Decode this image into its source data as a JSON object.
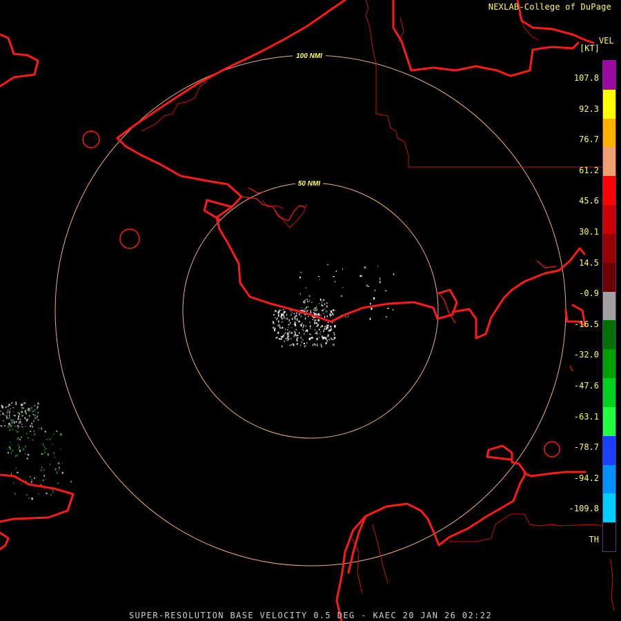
{
  "credit": "NEXLAB-College of DuPage",
  "product_title": "SUPER-RESOLUTION BASE VELOCITY 0.5 DEG - KAEC 20 JAN 26 02:22",
  "legend": {
    "title": "VEL",
    "units": "[KT]",
    "ticks": [
      "107.8",
      "92.3",
      "76.7",
      "61.2",
      "45.6",
      "30.1",
      "14.5",
      "-0.9",
      "-16.5",
      "-32.0",
      "-47.6",
      "-63.1",
      "-78.7",
      "-94.2",
      "-109.8",
      "TH"
    ],
    "colors": [
      "#9a0aa0",
      "#ffff00",
      "#ffb000",
      "#f0a070",
      "#ff0000",
      "#c80000",
      "#960000",
      "#6a0000",
      "#a0a0a0",
      "#007000",
      "#00a000",
      "#00d020",
      "#20ff40",
      "#1a40ff",
      "#0090ff",
      "#00ccff",
      "#000000"
    ]
  },
  "range_rings": [
    {
      "label": "50 NMI",
      "radius_nmi": 50
    },
    {
      "label": "100 NMI",
      "radius_nmi": 100
    }
  ],
  "colors": {
    "coastline": "#ff1a1a",
    "border": "#cc1111",
    "ring": "#f0b080",
    "ring_label": "#ffff55",
    "text": "#ffff55"
  }
}
